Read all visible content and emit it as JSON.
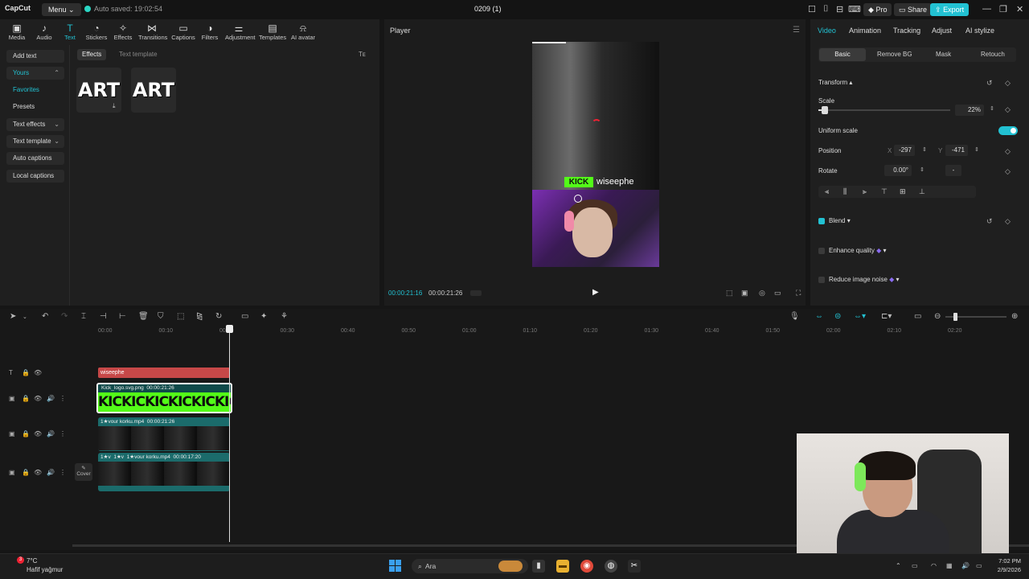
{
  "app": {
    "logo": "CapCut",
    "menu": "Menu",
    "autosave": "Auto saved: 19:02:54",
    "project": "0209 (1)",
    "pro": "Pro",
    "share": "Share",
    "export": "Export"
  },
  "toolbar": [
    {
      "icon": "media-icon",
      "glyph": "▣",
      "label": "Media"
    },
    {
      "icon": "audio-icon",
      "glyph": "♪",
      "label": "Audio"
    },
    {
      "icon": "text-icon",
      "glyph": "T",
      "label": "Text"
    },
    {
      "icon": "stickers-icon",
      "glyph": "◔",
      "label": "Stickers"
    },
    {
      "icon": "effects-icon",
      "glyph": "✧",
      "label": "Effects"
    },
    {
      "icon": "transitions-icon",
      "glyph": "⋈",
      "label": "Transitions"
    },
    {
      "icon": "captions-icon",
      "glyph": "▭",
      "label": "Captions"
    },
    {
      "icon": "filters-icon",
      "glyph": "◑",
      "label": "Filters"
    },
    {
      "icon": "adjustment-icon",
      "glyph": "⚌",
      "label": "Adjustment"
    },
    {
      "icon": "templates-icon",
      "glyph": "▤",
      "label": "Templates"
    },
    {
      "icon": "ai-avatar-icon",
      "glyph": "⍾",
      "label": "AI avatar"
    }
  ],
  "sidebar": {
    "add_text": "Add text",
    "yours": "Yours",
    "favorites": "Favorites",
    "presets": "Presets",
    "text_effects": "Text effects",
    "text_template": "Text template",
    "auto_captions": "Auto captions",
    "local_captions": "Local captions"
  },
  "effects": {
    "tab_effects": "Effects",
    "tab_text_template": "Text template",
    "filter": "Tᴇ",
    "items": [
      "ART",
      "ART"
    ]
  },
  "player": {
    "title": "Player",
    "overlay_logo": "KICK",
    "overlay_text": "wiseephe",
    "time_current": "00:00:21:16",
    "time_total": "00:00:21:26"
  },
  "inspector": {
    "tabs": [
      "Video",
      "Animation",
      "Tracking",
      "Adjust",
      "AI stylize"
    ],
    "subtabs": [
      "Basic",
      "Remove BG",
      "Mask",
      "Retouch"
    ],
    "transform": "Transform",
    "scale_label": "Scale",
    "scale_value": "22%",
    "uniform_scale": "Uniform scale",
    "position_label": "Position",
    "pos_x_label": "X",
    "pos_x": "-297",
    "pos_y_label": "Y",
    "pos_y": "-471",
    "rotate_label": "Rotate",
    "rotate_value": "0.00°",
    "rotate_extra": "-",
    "blend": "Blend",
    "enhance": "Enhance quality",
    "reduce_noise": "Reduce image noise"
  },
  "timeline": {
    "ruler": [
      "00:00",
      "00:10",
      "00:20",
      "00:30",
      "00:40",
      "00:50",
      "01:00",
      "01:10",
      "01:20",
      "01:30",
      "01:40",
      "01:50",
      "02:00",
      "02:10",
      "02:20"
    ],
    "text_clip": "wiseephe",
    "kick_clip_label": "Kick_logo.svg.png",
    "kick_clip_time": "00:00:21:26",
    "kick_strip": "KICKICKICKICKICKICKICK",
    "video1_label": "1★vour korku.mp4",
    "video1_time": "00:00:21:26",
    "video2_label_a": "1★v",
    "video2_label_b": "1★v",
    "video2_label_c": "1★vour korku.mp4",
    "video2_time": "00:00:17:20",
    "cover": "Cover"
  },
  "taskbar": {
    "badge": "3",
    "temp": "7°C",
    "weather": "Hafif yağmur",
    "search": "Ara",
    "time": "7:02 PM",
    "date": "2/9/2026"
  },
  "colors": {
    "accent": "#22c1d2",
    "kick_green": "#53fc18",
    "text_clip": "#c64848"
  }
}
